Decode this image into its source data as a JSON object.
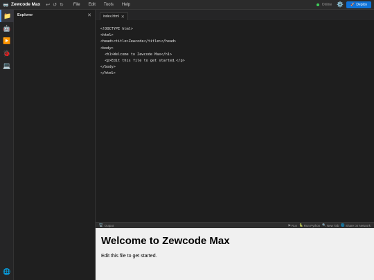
{
  "app": {
    "name": "Zewcode Max",
    "logo_icon": "🥽"
  },
  "history": {
    "undo": "↩",
    "refresh": "↺",
    "redo": "↻"
  },
  "menu": [
    "File",
    "Edit",
    "Tools",
    "Help"
  ],
  "status": {
    "text": "Online",
    "color": "#3ecf5a"
  },
  "settings_icon": "⚙️",
  "deploy": {
    "icon": "🚀",
    "label": "Deploy",
    "color": "#0e72d8"
  },
  "activity": [
    {
      "name": "explorer",
      "icon": "📁"
    },
    {
      "name": "ai-assistant",
      "icon": "🤖"
    },
    {
      "name": "run",
      "icon": "▶️"
    },
    {
      "name": "debug",
      "icon": "🐞"
    },
    {
      "name": "terminal",
      "icon": "💻"
    }
  ],
  "activity_bottom_icon": "🌐",
  "explorer": {
    "title": "Explorer",
    "close": "✕"
  },
  "tabs": [
    {
      "label": "index.html",
      "close": "✕"
    }
  ],
  "editor": {
    "code": "<!DOCTYPE html>\n<html>\n<head><title>Zewcode</title></head>\n<body>\n  <h1>Welcome to Zewcode Max</h1>\n  <p>Edit this file to get started.</p>\n</body>\n</html>"
  },
  "output": {
    "label": "Output",
    "icon": "🖥️",
    "actions": [
      {
        "icon": "▶",
        "label": "Run"
      },
      {
        "icon": "🐍",
        "label": "Run Python"
      },
      {
        "icon": "🔍",
        "label": "New Tab"
      },
      {
        "icon": "🌐",
        "label": "Share on Network"
      }
    ]
  },
  "preview": {
    "heading": "Welcome to Zewcode Max",
    "paragraph": "Edit this file to get started."
  }
}
